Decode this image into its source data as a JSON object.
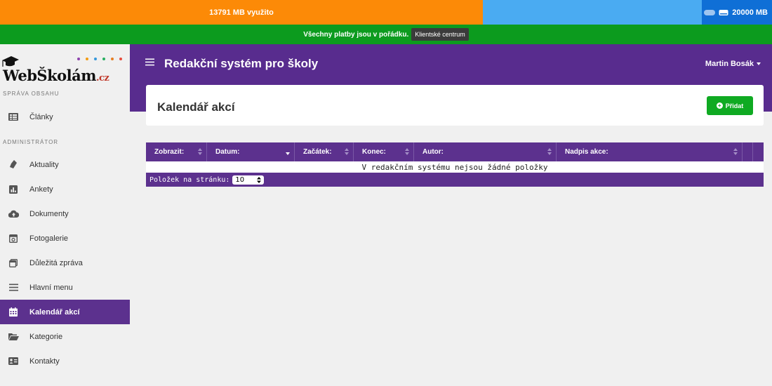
{
  "storage": {
    "used_label": "13791 MB využito",
    "used_fraction": 0.6896,
    "total_label": "20000 MB",
    "used_color": "#fc8a07",
    "free_color": "#4aabf2",
    "total_color": "#0f6fd6"
  },
  "payment": {
    "status_text": "Všechny platby jsou v pořádku.",
    "client_center_label": "Klientské centrum",
    "bar_color": "#0c9b1e"
  },
  "logo": {
    "text": "WebŠkolám",
    "suffix": ".cz",
    "dot_colors": [
      "#8e44ad",
      "#f39c12",
      "#3498db",
      "#27ae60",
      "#e67e22",
      "#e74c3c"
    ]
  },
  "sidebar": {
    "section_content": "SPRÁVA OBSAHU",
    "section_admin": "ADMINISTRÁTOR",
    "items": [
      {
        "label": "Články",
        "icon": "articles-icon"
      },
      {
        "label": "Aktuality",
        "icon": "news-icon"
      },
      {
        "label": "Ankety",
        "icon": "poll-icon"
      },
      {
        "label": "Dokumenty",
        "icon": "cloud-upload-icon"
      },
      {
        "label": "Fotogalerie",
        "icon": "photo-gallery-icon"
      },
      {
        "label": "Důležitá zpráva",
        "icon": "window-icon"
      },
      {
        "label": "Hlavní menu",
        "icon": "menu-icon"
      },
      {
        "label": "Kalendář akcí",
        "icon": "calendar-icon",
        "active": true
      },
      {
        "label": "Kategorie",
        "icon": "folder-open-icon"
      },
      {
        "label": "Kontakty",
        "icon": "contact-card-icon"
      }
    ]
  },
  "header": {
    "title": "Redakční systém pro školy",
    "user": "Martin Bosák",
    "color": "#582c8e"
  },
  "page": {
    "title": "Kalendář akcí",
    "add_label": "Přidat"
  },
  "table": {
    "columns": [
      "Zobrazit:",
      "Datum:",
      "Začátek:",
      "Konec:",
      "Autor:",
      "Nadpis akce:"
    ],
    "sorted_column": "Datum:",
    "empty_text": "V redakčním systému nejsou žádné položky",
    "per_page_label": "Položek na stránku:",
    "per_page_value": "10"
  }
}
